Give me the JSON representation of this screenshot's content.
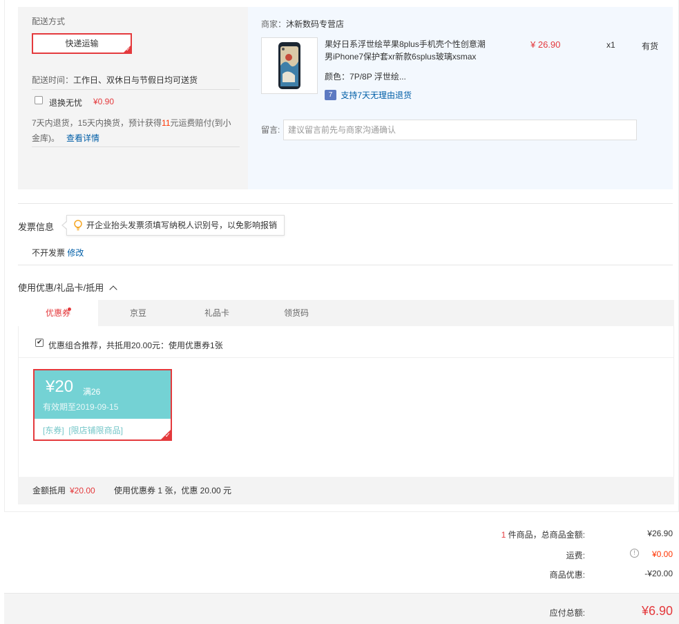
{
  "shipping": {
    "title": "配送方式",
    "method": "快递运输",
    "time_label": "配送时间：",
    "time_value": "工作日、双休日与节假日均可送货",
    "worry_free_label": "退换无忧",
    "worry_free_price": "¥0.90",
    "policy_text_1": "7天内退货，15天内换货，预计获得",
    "policy_highlight": "11",
    "policy_text_2": "元运费赔付(到小",
    "policy_text_3": "金库)。",
    "policy_link": "查看详情"
  },
  "store": {
    "seller_label": "商家：",
    "seller_name": "沐新数码专营店",
    "product_title_line1": "果好日系浮世绘苹果8plus手机壳个性创意潮",
    "product_title_line2": "男iPhone7保护套xr新款6splus玻璃xsmax",
    "color_label": "颜色：",
    "color_value": "7P/8P 浮世绘...",
    "price": "¥ 26.90",
    "qty": "x1",
    "stock": "有货",
    "return_badge": "7",
    "return_text": "支持7天无理由退货",
    "comment_label": "留言:",
    "comment_placeholder": "建议留言前先与商家沟通确认"
  },
  "invoice": {
    "title": "发票信息",
    "tip": "开企业抬头发票须填写纳税人识别号，以免影响报销",
    "status": "不开发票",
    "edit": "修改"
  },
  "discount": {
    "title": "使用优惠/礼品卡/抵用",
    "tabs": [
      "优惠券",
      "京豆",
      "礼品卡",
      "领货码"
    ],
    "recommend_text": "优惠组合推荐，共抵用20.00元：使用优惠券1张",
    "coupon": {
      "amount": "¥20",
      "threshold": "满26",
      "expiry": "有效期至2019-09-15",
      "tag1": "[东券]",
      "tag2": "[限店铺限商品]"
    },
    "summary_label": "金额抵用",
    "summary_amount": "¥20.00",
    "summary_text": "使用优惠券 1 张，优惠 20.00 元"
  },
  "totals": {
    "count": "1",
    "count_label": "件商品，总商品金额:",
    "goods_amount": "¥26.90",
    "shipping_label": "运费:",
    "shipping_amount": "¥0.00",
    "discount_label": "商品优惠:",
    "discount_amount": "-¥20.00",
    "payable_label": "应付总额:",
    "payable_amount": "¥6.90"
  },
  "colors": {
    "accent_red": "#e4393c",
    "link_blue": "#005ea7",
    "coupon_teal": "#74d2d4"
  }
}
